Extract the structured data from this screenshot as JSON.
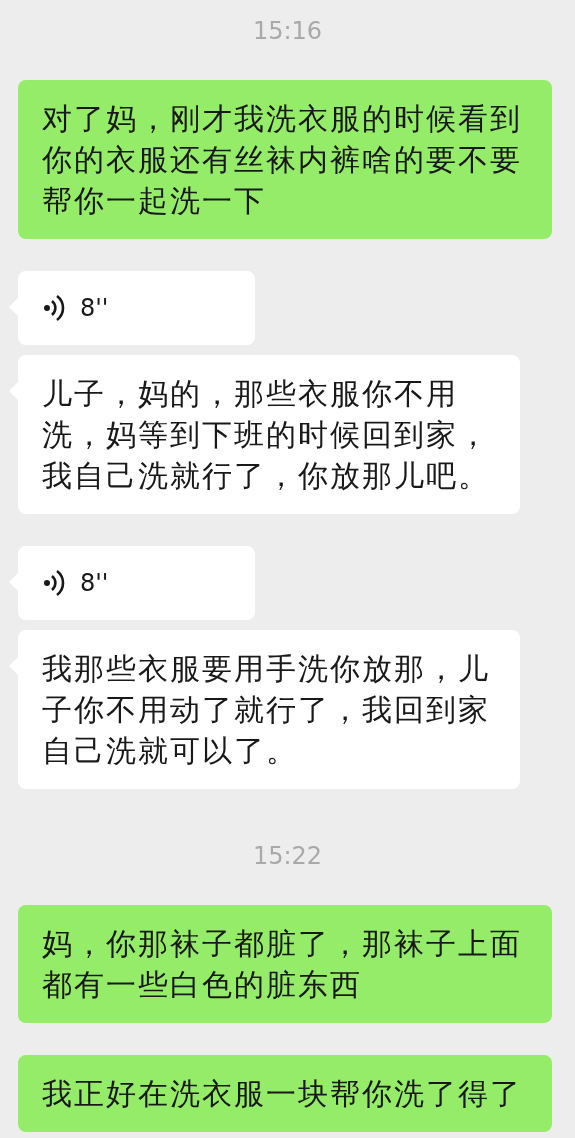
{
  "messages": [
    {
      "kind": "time",
      "text": "15:16"
    },
    {
      "kind": "text",
      "outgoing": true,
      "text": "对了妈，刚才我洗衣服的时候看到你的衣服还有丝袜内裤啥的要不要帮你一起洗一下"
    },
    {
      "kind": "voice",
      "outgoing": false,
      "text": "8''"
    },
    {
      "kind": "text",
      "outgoing": false,
      "text": "儿子，妈的，那些衣服你不用洗，妈等到下班的时候回到家，我自己洗就行了，你放那儿吧。"
    },
    {
      "kind": "voice",
      "outgoing": false,
      "text": "8''"
    },
    {
      "kind": "text",
      "outgoing": false,
      "text": "我那些衣服要用手洗你放那，儿子你不用动了就行了，我回到家自己洗就可以了。"
    },
    {
      "kind": "time",
      "text": "15:22"
    },
    {
      "kind": "text",
      "outgoing": true,
      "text": "妈，你那袜子都脏了，那袜子上面都有一些白色的脏东西"
    },
    {
      "kind": "text",
      "outgoing": true,
      "text": "我正好在洗衣服一块帮你洗了得了"
    }
  ]
}
